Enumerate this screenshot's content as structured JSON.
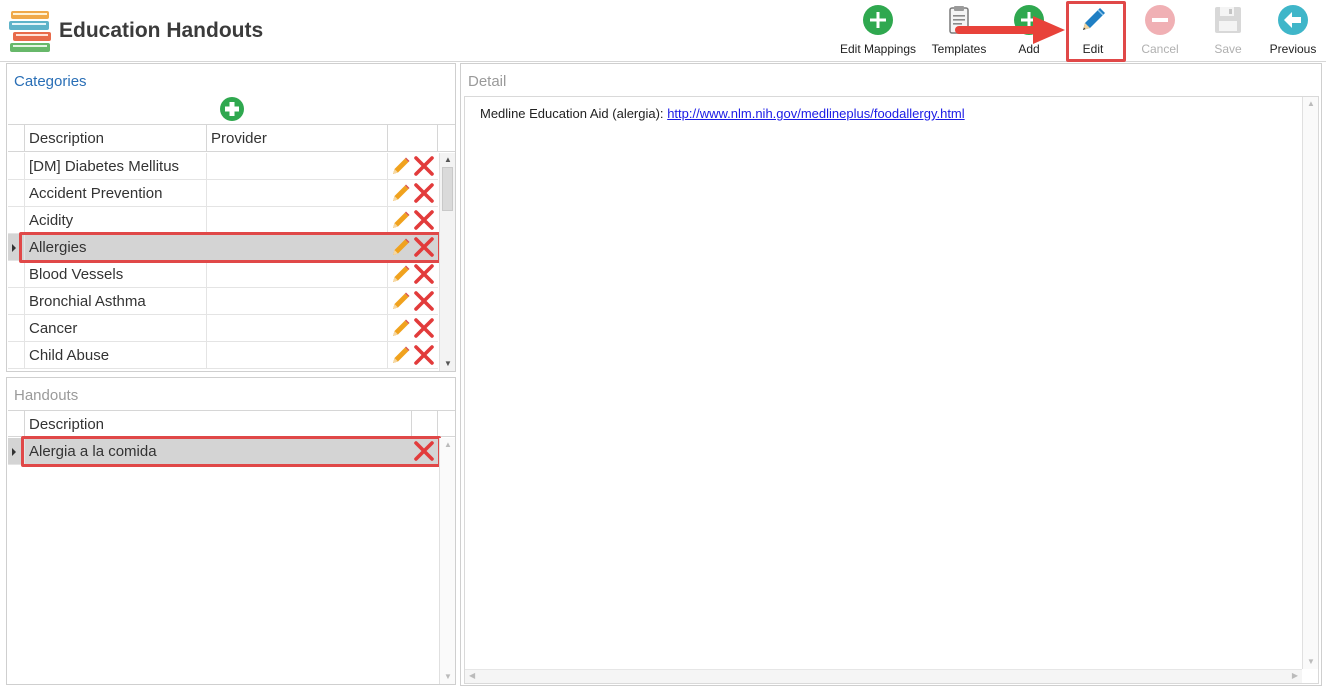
{
  "app": {
    "title": "Education Handouts"
  },
  "toolbar": {
    "edit_mappings": "Edit Mappings",
    "templates": "Templates",
    "add": "Add",
    "edit": "Edit",
    "cancel": "Cancel",
    "save": "Save",
    "previous": "Previous"
  },
  "categories": {
    "title": "Categories",
    "columns": [
      "Description",
      "Provider"
    ],
    "rows": [
      {
        "description": "[DM] Diabetes Mellitus",
        "provider": ""
      },
      {
        "description": "Accident Prevention",
        "provider": ""
      },
      {
        "description": "Acidity",
        "provider": ""
      },
      {
        "description": "Allergies",
        "provider": ""
      },
      {
        "description": "Blood Vessels",
        "provider": ""
      },
      {
        "description": "Bronchial Asthma",
        "provider": ""
      },
      {
        "description": "Cancer",
        "provider": ""
      },
      {
        "description": "Child Abuse",
        "provider": ""
      }
    ],
    "selected": "Allergies"
  },
  "handouts": {
    "title": "Handouts",
    "columns": [
      "Description"
    ],
    "rows": [
      {
        "description": "Alergia a la comida"
      }
    ]
  },
  "detail": {
    "title": "Detail",
    "text": "Medline Education Aid (alergia):",
    "link": "http://www.nlm.nih.gov/medlineplus/foodallergy.html"
  },
  "colors": {
    "accent_blue": "#2a6fb6",
    "highlight_red": "#e04848",
    "add_green": "#2fa84f",
    "edit_blue": "#1f7fc4",
    "previous_teal": "#3fb6c9",
    "selected_row": "#d4d4d4"
  },
  "icons": {
    "logo": "books-icon",
    "edit_mappings": "plus-circle-icon",
    "templates": "clipboard-icon",
    "add": "plus-circle-icon",
    "edit": "pencil-icon",
    "cancel": "minus-circle-icon",
    "save": "floppy-disk-icon",
    "previous": "arrow-left-circle-icon",
    "row_edit": "pencil-icon",
    "row_delete": "red-x-icon"
  }
}
